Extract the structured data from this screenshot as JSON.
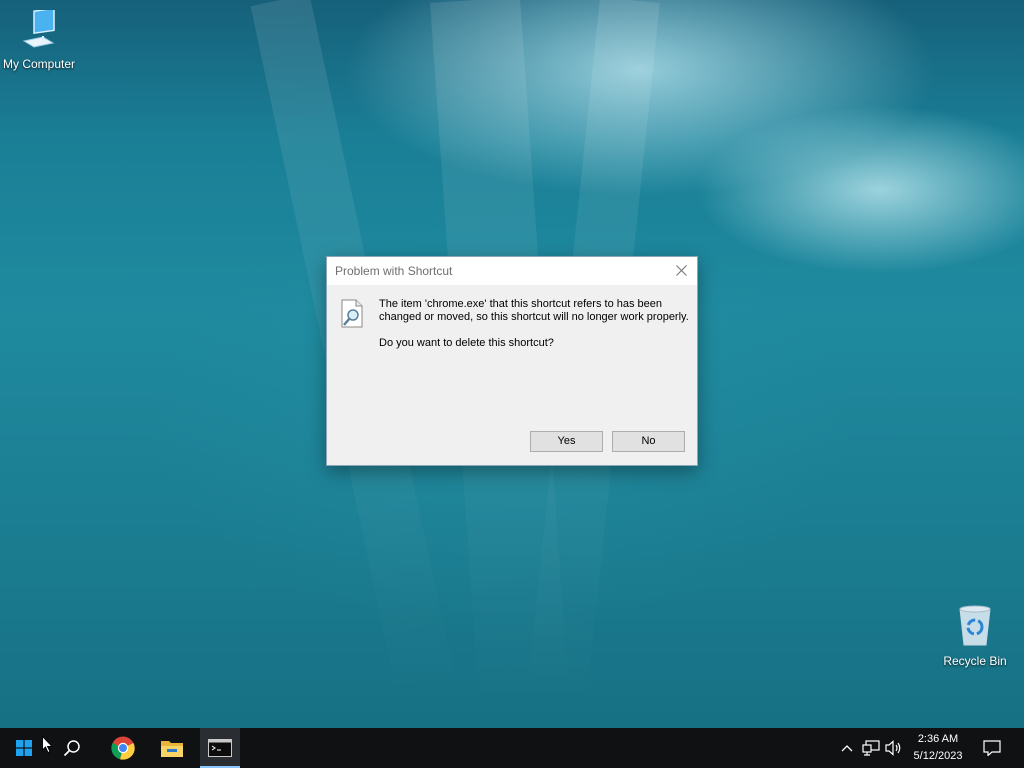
{
  "desktop": {
    "icons": [
      {
        "label": "My Computer",
        "icon": "computer-icon"
      },
      {
        "label": "Recycle Bin",
        "icon": "recycle-bin-icon"
      }
    ]
  },
  "dialog": {
    "title": "Problem with Shortcut",
    "message": "The item 'chrome.exe' that this shortcut refers to has been changed or moved, so this shortcut will no longer work properly.",
    "question": "Do you want to delete this shortcut?",
    "yes_label": "Yes",
    "no_label": "No",
    "icon": "search-document-icon"
  },
  "taskbar": {
    "pinned": [
      "start-icon",
      "search-icon",
      "chrome-icon",
      "file-explorer-icon",
      "terminal-icon"
    ],
    "tray": {
      "time": "2:36 AM",
      "date": "5/12/2023",
      "icons": [
        "chevron-up-icon",
        "network-icon",
        "volume-icon",
        "notification-icon"
      ]
    }
  },
  "colors": {
    "taskbar": "#0f1113",
    "dialog_bg": "#f0f0f0",
    "button_bg": "#e1e1e1",
    "desktop": "#1a7f96"
  }
}
